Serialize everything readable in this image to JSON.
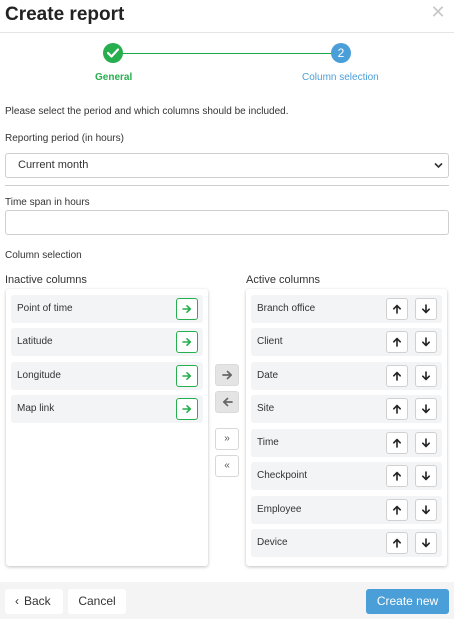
{
  "dialog": {
    "title": "Create report",
    "close_icon": "close-icon"
  },
  "wizard": {
    "steps": [
      {
        "label": "General",
        "state": "completed",
        "color": "#27ae4f"
      },
      {
        "label": "Column selection",
        "number": "2",
        "state": "active",
        "color": "#4a9fd8"
      }
    ]
  },
  "form": {
    "intro": "Please select the period and which columns should be included.",
    "period_label": "Reporting period (in hours)",
    "period_value": "Current month",
    "timespan_label": "Time span in hours",
    "timespan_value": "",
    "column_selection_label": "Column selection"
  },
  "inactive": {
    "heading": "Inactive columns",
    "items": [
      "Point of time",
      "Latitude",
      "Longitude",
      "Map link"
    ]
  },
  "active": {
    "heading": "Active columns",
    "items": [
      "Branch office",
      "Client",
      "Date",
      "Site",
      "Time",
      "Checkpoint",
      "Employee",
      "Device"
    ]
  },
  "transfer": {
    "move_all_right": "»",
    "move_all_left": "«"
  },
  "footer": {
    "back": "Back",
    "cancel": "Cancel",
    "create": "Create new"
  },
  "colors": {
    "accent": "#4a9fd8",
    "success": "#27ae4f"
  }
}
